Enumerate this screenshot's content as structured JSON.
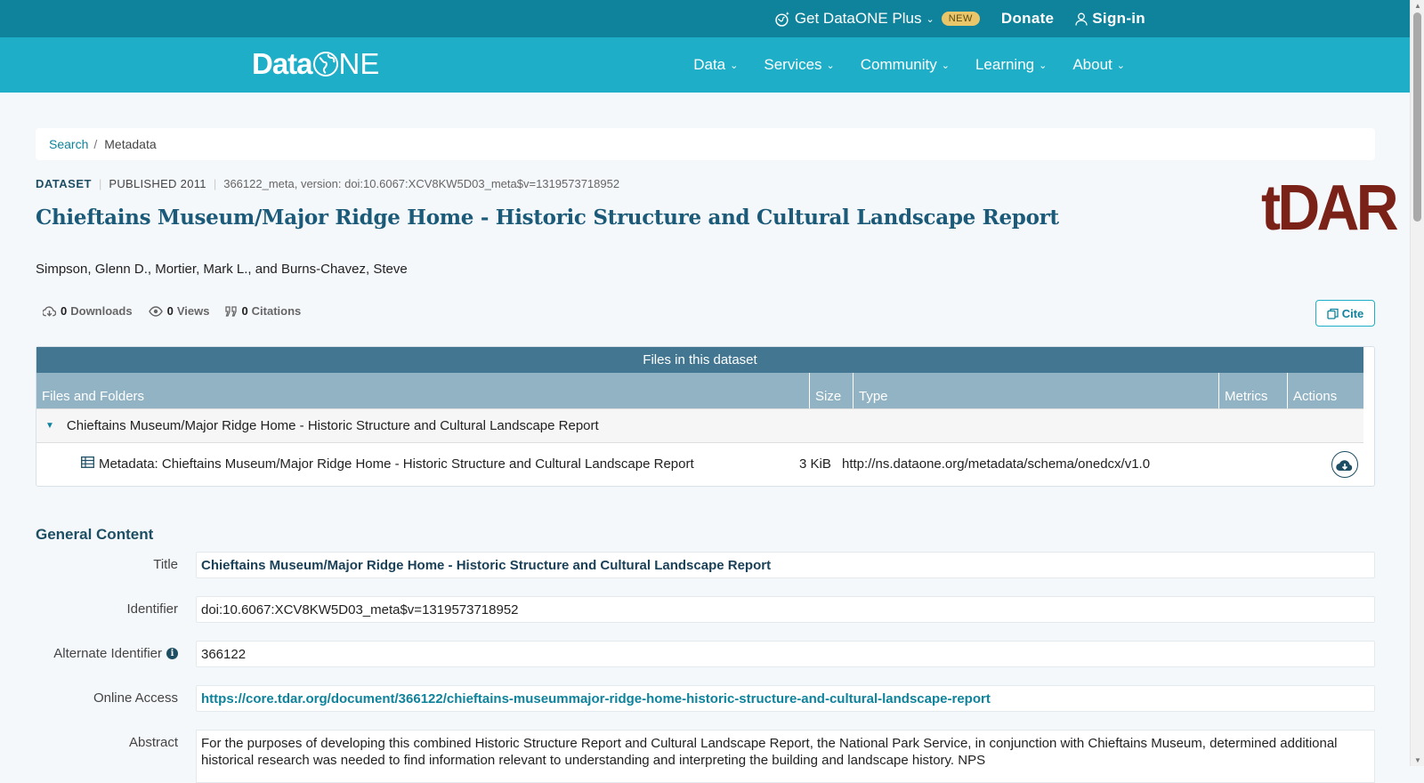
{
  "topbar": {
    "plus_label": "Get DataONE Plus",
    "new_badge": "NEW",
    "donate_label": "Donate",
    "signin_label": "Sign-in"
  },
  "brand": {
    "logo_data": "Data",
    "logo_one": "ONE"
  },
  "nav": {
    "items": [
      {
        "label": "Data"
      },
      {
        "label": "Services"
      },
      {
        "label": "Community"
      },
      {
        "label": "Learning"
      },
      {
        "label": "About"
      }
    ]
  },
  "breadcrumb": {
    "search": "Search",
    "separator": "/",
    "current": "Metadata"
  },
  "dataset": {
    "type": "DATASET",
    "published": "PUBLISHED 2011",
    "id_line": "366122_meta, version: doi:10.6067:XCV8KW5D03_meta$v=1319573718952",
    "title": "Chieftains Museum/Major Ridge Home - Historic Structure and Cultural Landscape Report",
    "repo_logo": "tDAR",
    "authors": "Simpson, Glenn D., Mortier, Mark L., and Burns-Chavez, Steve"
  },
  "metrics": {
    "downloads_count": "0",
    "downloads_label": "Downloads",
    "views_count": "0",
    "views_label": "Views",
    "citations_count": "0",
    "citations_label": "Citations"
  },
  "cite_label": "Cite",
  "files": {
    "header": "Files in this dataset",
    "columns": [
      "Files and Folders",
      "Size",
      "Type",
      "Metrics",
      "Actions"
    ],
    "folder_name": "Chieftains Museum/Major Ridge Home - Historic Structure and Cultural Landscape Report",
    "file": {
      "name": "Metadata: Chieftains Museum/Major Ridge Home - Historic Structure and Cultural Landscape Report",
      "size": "3 KiB",
      "type": "http://ns.dataone.org/metadata/schema/onedcx/v1.0"
    }
  },
  "general": {
    "section_title": "General Content",
    "title_label": "Title",
    "title_value": "Chieftains Museum/Major Ridge Home - Historic Structure and Cultural Landscape Report",
    "identifier_label": "Identifier",
    "identifier_value": "doi:10.6067:XCV8KW5D03_meta$v=1319573718952",
    "alt_identifier_label": "Alternate Identifier",
    "alt_identifier_value": "366122",
    "online_access_label": "Online Access",
    "online_access_value": "https://core.tdar.org/document/366122/chieftains-museummajor-ridge-home-historic-structure-and-cultural-landscape-report",
    "abstract_label": "Abstract",
    "abstract_value": "For the purposes of developing this combined Historic Structure Report and Cultural Landscape Report, the National Park Service, in conjunction with Chieftains Museum, determined additional historical research was needed to find information relevant to understanding and interpreting the building and landscape history. NPS"
  },
  "colors": {
    "topbar": "#0f839b",
    "nav": "#1eaec8",
    "title": "#1b5a78",
    "files_header": "#437791",
    "files_cols": "#92b3c4",
    "tdar": "#7a2118",
    "badge": "#e9c66a"
  }
}
